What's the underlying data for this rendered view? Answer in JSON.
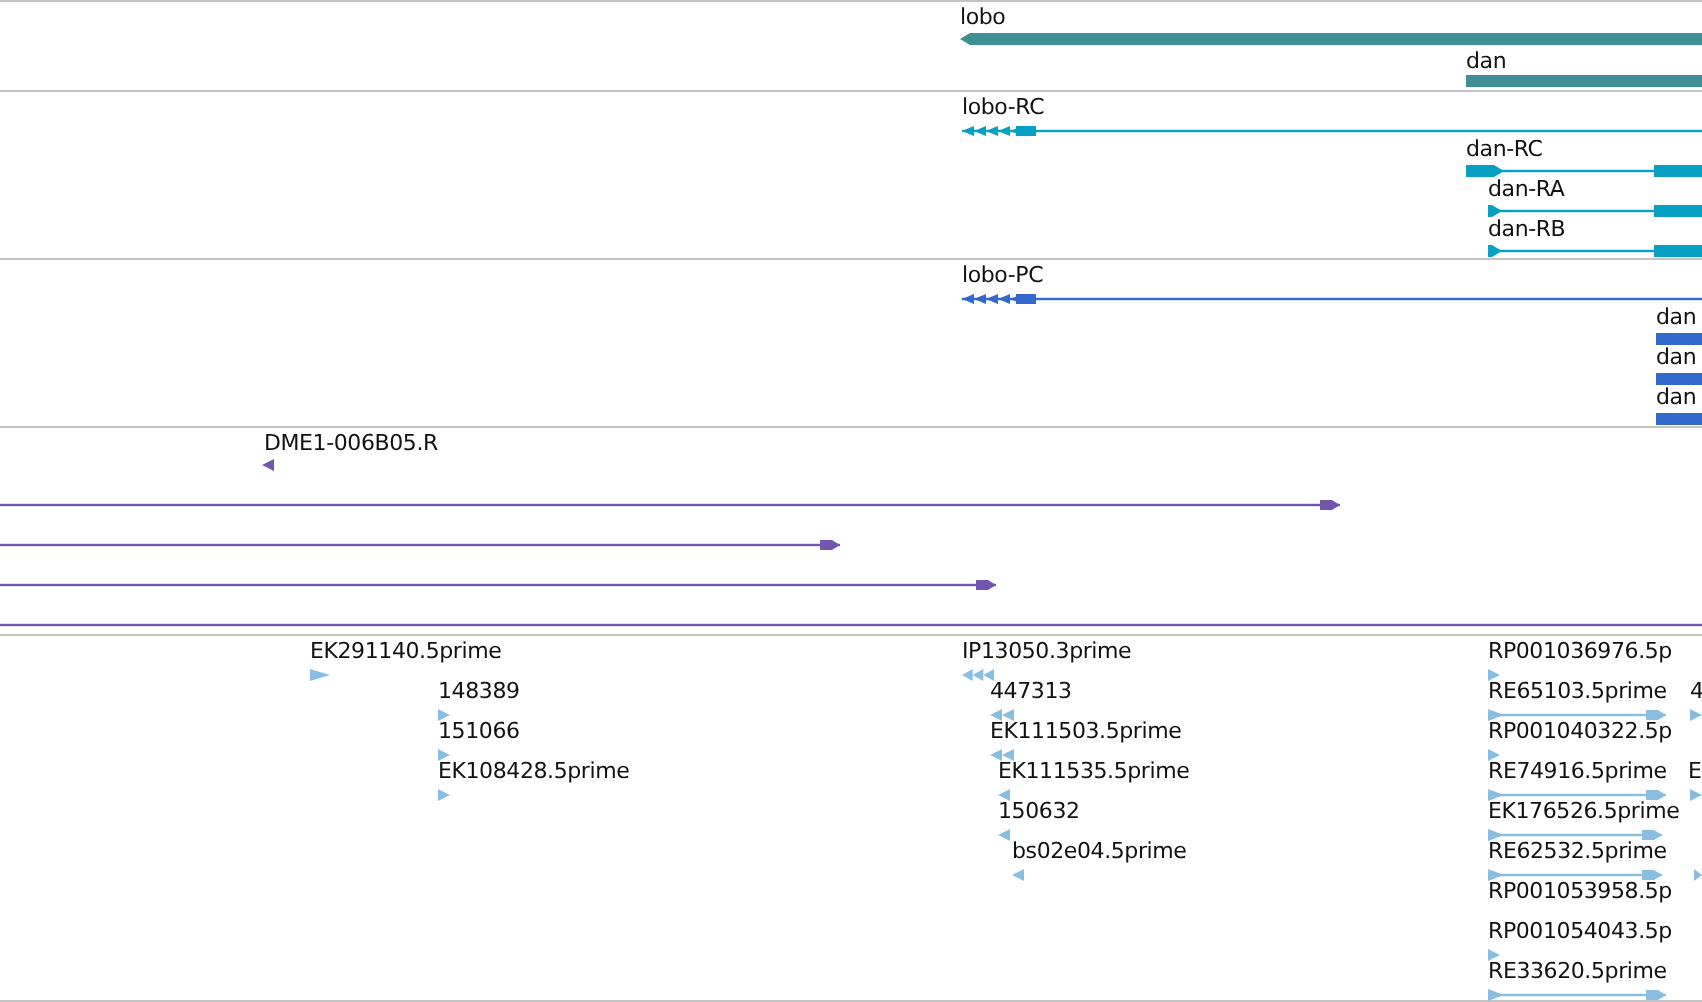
{
  "tracks": [
    {
      "color": "#3f8f94",
      "features": [
        {
          "kind": "gene",
          "label": "lobo"
        },
        {
          "kind": "gene",
          "label": "dan"
        }
      ]
    },
    {
      "color": "#08a0c2",
      "features": [
        {
          "kind": "transcript",
          "label": "lobo-RC"
        },
        {
          "kind": "transcript",
          "label": "dan-RC"
        },
        {
          "kind": "transcript",
          "label": "dan-RA"
        },
        {
          "kind": "transcript",
          "label": "dan-RB"
        }
      ]
    },
    {
      "color": "#3368cc",
      "features": [
        {
          "kind": "transcript",
          "label": "lobo-PC"
        },
        {
          "kind": "gene",
          "label": "dan"
        },
        {
          "kind": "gene",
          "label": "dan"
        },
        {
          "kind": "gene",
          "label": "dan"
        }
      ]
    },
    {
      "color": "#7455ad",
      "features": [
        {
          "kind": "read",
          "label": "DME1-006B05.R"
        },
        {
          "kind": "span"
        },
        {
          "kind": "span"
        },
        {
          "kind": "span"
        },
        {
          "kind": "span"
        }
      ]
    },
    {
      "color": "#8abde2",
      "features": [
        {
          "kind": "read",
          "label": "EK291140.5prime"
        },
        {
          "kind": "read",
          "label": "148389"
        },
        {
          "kind": "read",
          "label": "151066"
        },
        {
          "kind": "read",
          "label": "EK108428.5prime"
        },
        {
          "kind": "read",
          "label": "IP13050.3prime"
        },
        {
          "kind": "read",
          "label": "447313"
        },
        {
          "kind": "read",
          "label": "EK111503.5prime"
        },
        {
          "kind": "read",
          "label": "EK111535.5prime"
        },
        {
          "kind": "read",
          "label": "150632"
        },
        {
          "kind": "read",
          "label": "bs02e04.5prime"
        },
        {
          "kind": "read",
          "label": "RP001036976.5p"
        },
        {
          "kind": "span",
          "label": "RE65103.5prime"
        },
        {
          "kind": "read",
          "label": "4"
        },
        {
          "kind": "read",
          "label": "RP001040322.5p"
        },
        {
          "kind": "span",
          "label": "RE74916.5prime"
        },
        {
          "kind": "read",
          "label": "E"
        },
        {
          "kind": "span",
          "label": "EK176526.5prime"
        },
        {
          "kind": "span",
          "label": "RE62532.5prime"
        },
        {
          "kind": "read"
        },
        {
          "kind": "read",
          "label": "RP001053958.5p"
        },
        {
          "kind": "read",
          "label": "RP001054043.5p"
        },
        {
          "kind": "span",
          "label": "RE33620.5prime"
        }
      ]
    }
  ]
}
